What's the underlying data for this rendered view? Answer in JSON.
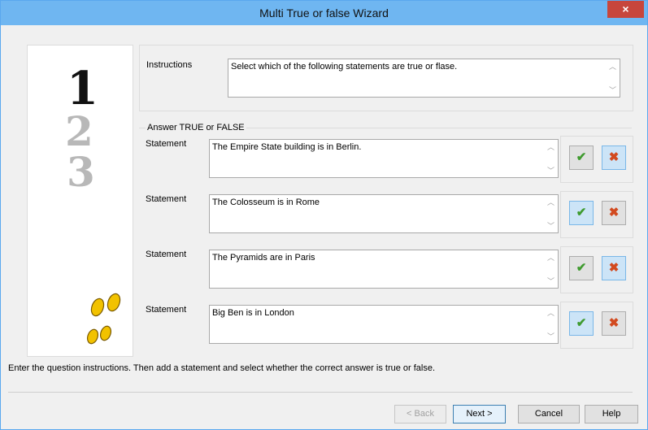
{
  "window": {
    "title": "Multi True or false Wizard",
    "close_glyph": "×"
  },
  "steps": [
    "1",
    "2",
    "3"
  ],
  "instructions": {
    "label": "Instructions",
    "value": "Select which of the following statements are true or flase."
  },
  "answers": {
    "legend": "Answer TRUE or FALSE",
    "rows": [
      {
        "label": "Statement",
        "text": "The Empire State building is in Berlin.",
        "selected": "false"
      },
      {
        "label": "Statement",
        "text": "The Colosseum is in Rome",
        "selected": "true"
      },
      {
        "label": "Statement",
        "text": "The Pyramids are in Paris",
        "selected": "false"
      },
      {
        "label": "Statement",
        "text": "Big Ben is in London",
        "selected": "true"
      }
    ],
    "true_icon": "check-icon",
    "false_icon": "x-icon"
  },
  "status_text": "Enter the question instructions. Then add a statement and select whether the correct answer is true or false.",
  "buttons": {
    "back": "< Back",
    "next": "Next >",
    "cancel": "Cancel",
    "help": "Help"
  },
  "colors": {
    "titlebar": "#6fb6f1",
    "close": "#c7463c",
    "check": "#3f9b2f",
    "cross": "#d24a1f",
    "pressed": "#cce4f7",
    "footprints": "#f2c200"
  }
}
